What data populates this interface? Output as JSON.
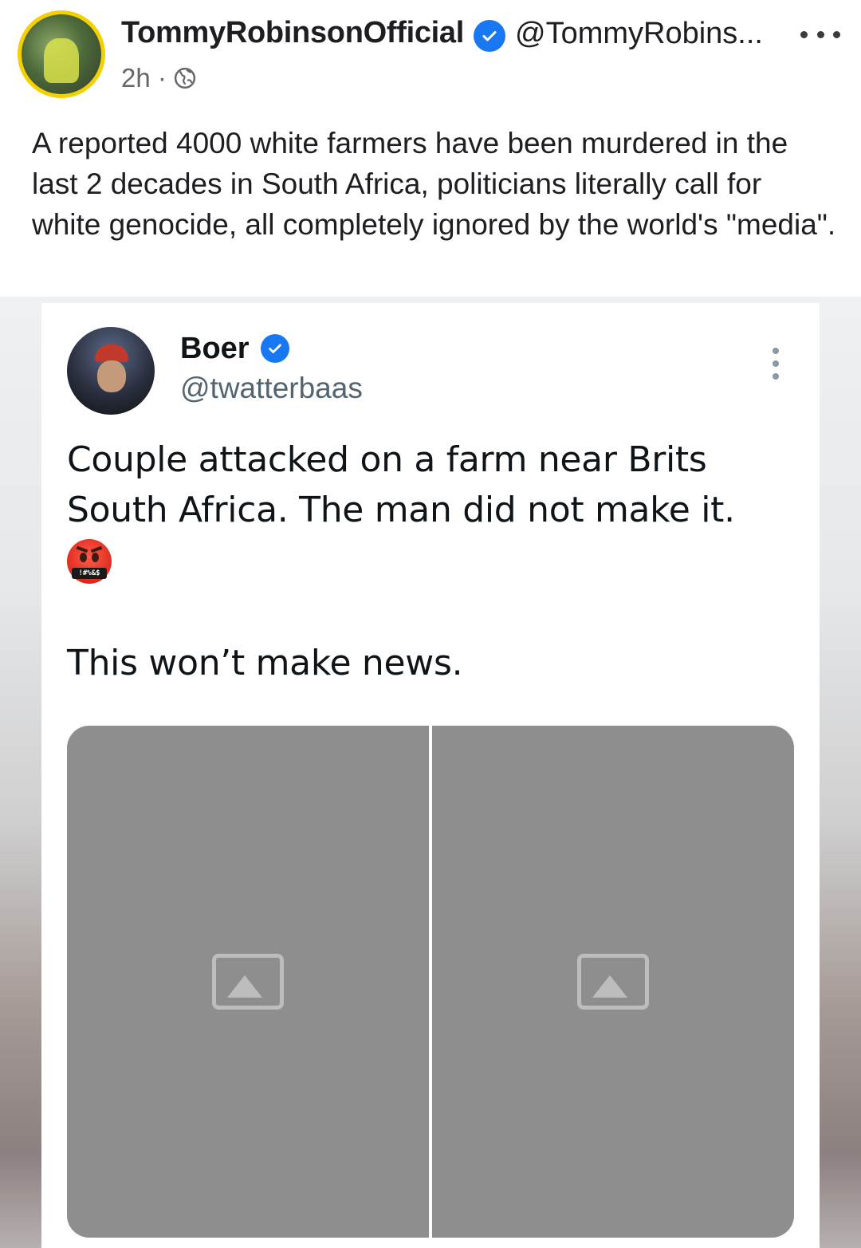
{
  "post": {
    "author_name": "TommyRobinsonOfficial",
    "author_handle": "@TommyRobins...",
    "time": "2h ·",
    "text": "A reported 4000 white farmers have been murdered in the last 2 decades in South Africa, politicians literally call for white genocide, all completely ignored by the world's \"media\"."
  },
  "embedded_tweet": {
    "display_name": "Boer",
    "handle": "@twatterbaas",
    "text_line1": "Couple attacked on a farm near Brits South Africa. The man did not make it.",
    "emoji_bar": "!#%&$",
    "text_line2": "This won’t make news."
  },
  "colors": {
    "verified": "#1877f2",
    "avatar_ring": "#f5d000"
  },
  "icons": {
    "more": "more-horizontal-icon",
    "audience": "globe-icon",
    "verified": "verified-badge-icon"
  }
}
